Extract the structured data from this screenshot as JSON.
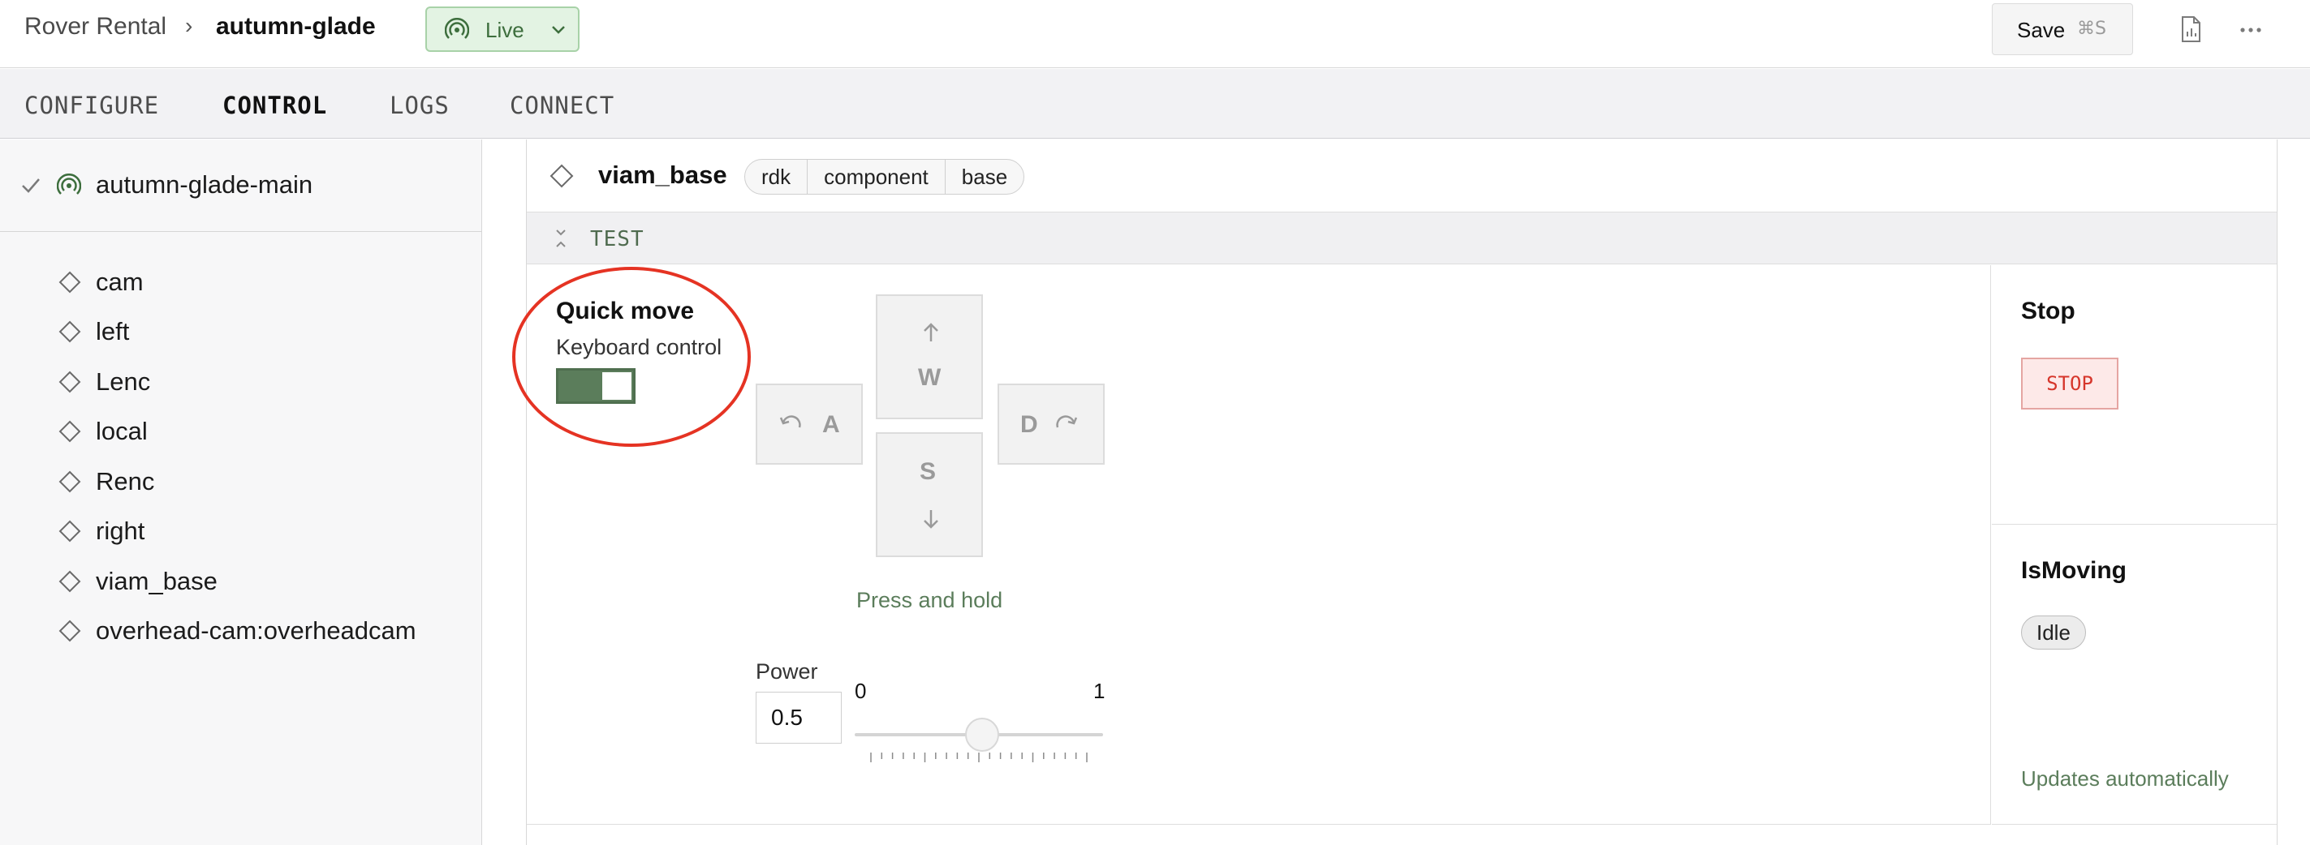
{
  "header": {
    "breadcrumb_parent": "Rover Rental",
    "breadcrumb_separator": "›",
    "breadcrumb_current": "autumn-glade",
    "status_label": "Live",
    "save_label": "Save",
    "save_shortcut": "⌘S"
  },
  "tabs": [
    {
      "label": "CONFIGURE",
      "active": false
    },
    {
      "label": "CONTROL",
      "active": true
    },
    {
      "label": "LOGS",
      "active": false
    },
    {
      "label": "CONNECT",
      "active": false
    }
  ],
  "sidebar": {
    "machine": "autumn-glade-main",
    "components": [
      "cam",
      "left",
      "Lenc",
      "local",
      "Renc",
      "right",
      "viam_base",
      "overhead-cam:overheadcam"
    ]
  },
  "card": {
    "component_name": "viam_base",
    "api": [
      "rdk",
      "component",
      "base"
    ],
    "section_label": "TEST",
    "quick_move_title": "Quick move",
    "keyboard_label": "Keyboard control",
    "keyboard_enabled": true,
    "keys": {
      "w": "W",
      "a": "A",
      "s": "S",
      "d": "D"
    },
    "press_hold": "Press and hold",
    "power_label": "Power",
    "power_value": "0.5",
    "slider_min": "0",
    "slider_max": "1",
    "stop_title": "Stop",
    "stop_button": "STOP",
    "moving_title": "IsMoving",
    "moving_state": "Idle",
    "updates_note": "Updates automatically"
  },
  "colors": {
    "accent_green": "#5b7d5b",
    "live_bg": "#e3f3e3",
    "stop_red": "#d6362b",
    "annotation_red": "#e53323"
  }
}
